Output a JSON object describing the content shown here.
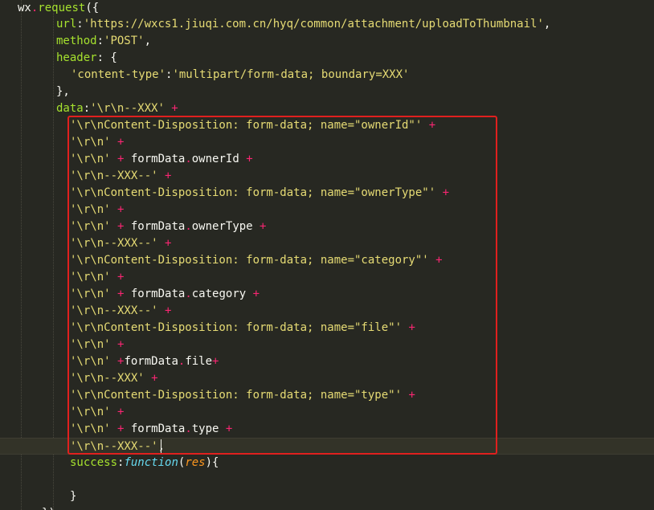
{
  "editor": {
    "lines": [
      {
        "tokens": [
          {
            "t": "wx",
            "c": "plain"
          },
          {
            "t": ".",
            "c": "pink"
          },
          {
            "t": "request",
            "c": "green"
          },
          {
            "t": "({",
            "c": "plain"
          }
        ]
      },
      {
        "tokens": [
          {
            "t": "url",
            "c": "green"
          },
          {
            "t": ":",
            "c": "plain"
          },
          {
            "t": "'https://wxcs1.jiuqi.com.cn/hyq/common/attachment/uploadToThumbnail'",
            "c": "yellow"
          },
          {
            "t": ",",
            "c": "plain"
          }
        ]
      },
      {
        "tokens": [
          {
            "t": "method",
            "c": "green"
          },
          {
            "t": ":",
            "c": "plain"
          },
          {
            "t": "'POST'",
            "c": "yellow"
          },
          {
            "t": ",",
            "c": "plain"
          }
        ]
      },
      {
        "tokens": [
          {
            "t": "header",
            "c": "green"
          },
          {
            "t": ": {",
            "c": "plain"
          }
        ]
      },
      {
        "tokens": [
          {
            "t": "'content-type'",
            "c": "yellow"
          },
          {
            "t": ":",
            "c": "plain"
          },
          {
            "t": "'multipart/form-data; boundary=XXX'",
            "c": "yellow"
          }
        ]
      },
      {
        "tokens": [
          {
            "t": "},",
            "c": "plain"
          }
        ]
      },
      {
        "tokens": [
          {
            "t": "data",
            "c": "green"
          },
          {
            "t": ":",
            "c": "plain"
          },
          {
            "t": "'\\r\\n--XXX'",
            "c": "yellow"
          },
          {
            "t": " +",
            "c": "pink"
          }
        ]
      },
      {
        "tokens": [
          {
            "t": "'\\r\\nContent-Disposition: form-data; name=\"ownerId\"'",
            "c": "yellow"
          },
          {
            "t": " +",
            "c": "pink"
          }
        ]
      },
      {
        "tokens": [
          {
            "t": "'\\r\\n'",
            "c": "yellow"
          },
          {
            "t": " +",
            "c": "pink"
          }
        ]
      },
      {
        "tokens": [
          {
            "t": "'\\r\\n'",
            "c": "yellow"
          },
          {
            "t": " + ",
            "c": "pink"
          },
          {
            "t": "formData",
            "c": "plain"
          },
          {
            "t": ".",
            "c": "pink"
          },
          {
            "t": "ownerId",
            "c": "plain"
          },
          {
            "t": " +",
            "c": "pink"
          }
        ]
      },
      {
        "tokens": [
          {
            "t": "'\\r\\n--XXX--'",
            "c": "yellow"
          },
          {
            "t": " +",
            "c": "pink"
          }
        ]
      },
      {
        "tokens": [
          {
            "t": "'\\r\\nContent-Disposition: form-data; name=\"ownerType\"'",
            "c": "yellow"
          },
          {
            "t": " +",
            "c": "pink"
          }
        ]
      },
      {
        "tokens": [
          {
            "t": "'\\r\\n'",
            "c": "yellow"
          },
          {
            "t": " +",
            "c": "pink"
          }
        ]
      },
      {
        "tokens": [
          {
            "t": "'\\r\\n'",
            "c": "yellow"
          },
          {
            "t": " + ",
            "c": "pink"
          },
          {
            "t": "formData",
            "c": "plain"
          },
          {
            "t": ".",
            "c": "pink"
          },
          {
            "t": "ownerType",
            "c": "plain"
          },
          {
            "t": " +",
            "c": "pink"
          }
        ]
      },
      {
        "tokens": [
          {
            "t": "'\\r\\n--XXX--'",
            "c": "yellow"
          },
          {
            "t": " +",
            "c": "pink"
          }
        ]
      },
      {
        "tokens": [
          {
            "t": "'\\r\\nContent-Disposition: form-data; name=\"category\"'",
            "c": "yellow"
          },
          {
            "t": " +",
            "c": "pink"
          }
        ]
      },
      {
        "tokens": [
          {
            "t": "'\\r\\n'",
            "c": "yellow"
          },
          {
            "t": " +",
            "c": "pink"
          }
        ]
      },
      {
        "tokens": [
          {
            "t": "'\\r\\n'",
            "c": "yellow"
          },
          {
            "t": " + ",
            "c": "pink"
          },
          {
            "t": "formData",
            "c": "plain"
          },
          {
            "t": ".",
            "c": "pink"
          },
          {
            "t": "category",
            "c": "plain"
          },
          {
            "t": " +",
            "c": "pink"
          }
        ]
      },
      {
        "tokens": [
          {
            "t": "'\\r\\n--XXX--'",
            "c": "yellow"
          },
          {
            "t": " +",
            "c": "pink"
          }
        ]
      },
      {
        "tokens": [
          {
            "t": "'\\r\\nContent-Disposition: form-data; name=\"file\"'",
            "c": "yellow"
          },
          {
            "t": " +",
            "c": "pink"
          }
        ]
      },
      {
        "tokens": [
          {
            "t": "'\\r\\n'",
            "c": "yellow"
          },
          {
            "t": " +",
            "c": "pink"
          }
        ]
      },
      {
        "tokens": [
          {
            "t": "'\\r\\n'",
            "c": "yellow"
          },
          {
            "t": " +",
            "c": "pink"
          },
          {
            "t": "formData",
            "c": "plain"
          },
          {
            "t": ".",
            "c": "pink"
          },
          {
            "t": "file",
            "c": "plain"
          },
          {
            "t": "+",
            "c": "pink"
          }
        ]
      },
      {
        "tokens": [
          {
            "t": "'\\r\\n--XXX'",
            "c": "yellow"
          },
          {
            "t": " +",
            "c": "pink"
          }
        ]
      },
      {
        "tokens": [
          {
            "t": "'\\r\\nContent-Disposition: form-data; name=\"type\"'",
            "c": "yellow"
          },
          {
            "t": " +",
            "c": "pink"
          }
        ]
      },
      {
        "tokens": [
          {
            "t": "'\\r\\n'",
            "c": "yellow"
          },
          {
            "t": " +",
            "c": "pink"
          }
        ]
      },
      {
        "tokens": [
          {
            "t": "'\\r\\n'",
            "c": "yellow"
          },
          {
            "t": " + ",
            "c": "pink"
          },
          {
            "t": "formData",
            "c": "plain"
          },
          {
            "t": ".",
            "c": "pink"
          },
          {
            "t": "type",
            "c": "plain"
          },
          {
            "t": " +",
            "c": "pink"
          }
        ]
      },
      {
        "tokens": [
          {
            "t": "'\\r\\n--XXX--'",
            "c": "yellow"
          },
          {
            "t": ",",
            "c": "plain"
          }
        ],
        "current": true
      },
      {
        "tokens": [
          {
            "t": "success",
            "c": "green"
          },
          {
            "t": ":",
            "c": "plain"
          },
          {
            "t": "function",
            "c": "blue"
          },
          {
            "t": "(",
            "c": "plain"
          },
          {
            "t": "res",
            "c": "orange"
          },
          {
            "t": "){",
            "c": "plain"
          }
        ]
      },
      {
        "tokens": []
      },
      {
        "tokens": [
          {
            "t": "}",
            "c": "plain"
          }
        ]
      },
      {
        "tokens": [
          {
            "t": "})",
            "c": "plain"
          }
        ]
      }
    ],
    "colors": {
      "background": "#272822",
      "highlight_box": "#e0201e"
    }
  }
}
